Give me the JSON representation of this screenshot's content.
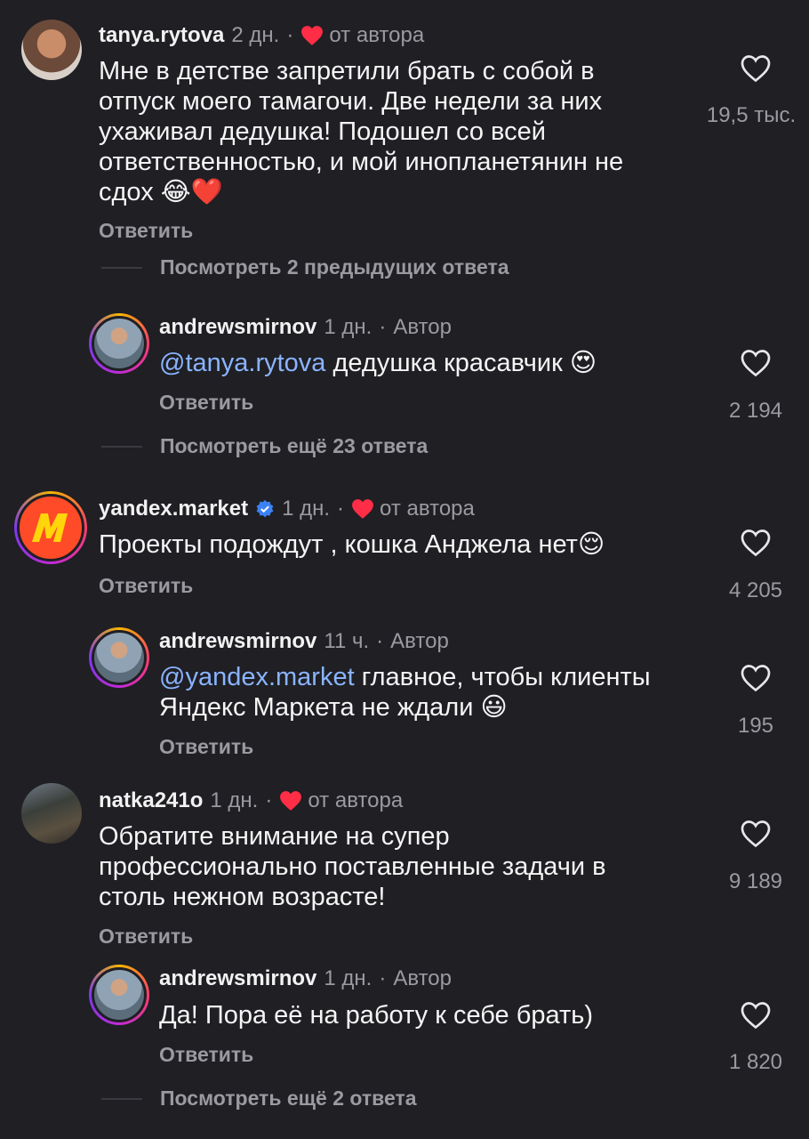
{
  "comments": [
    {
      "user": "tanya.rytova",
      "time": "2 дн.",
      "sep": "·",
      "tag": "от автора",
      "text": "Мне в детстве запретили брать с собой в отпуск моего тамагочи. Две недели за них ухаживал дедушка! Подошел со всей ответственностью, и мой инопланетянин не сдох 😂❤️",
      "reply": "Ответить",
      "likes": "19,5 тыс.",
      "view_more": "Посмотреть 2 предыдущих ответа"
    },
    {
      "user": "andrewsmirnov",
      "time": "1 дн.",
      "sep": "·",
      "tag": "Автор",
      "mention": "@tanya.rytova",
      "text": " дедушка красавчик 😍",
      "reply": "Ответить",
      "likes": "2 194",
      "view_more": "Посмотреть ещё 23 ответа"
    },
    {
      "user": "yandex.market",
      "time": "1 дн.",
      "sep": "·",
      "tag": "от автора",
      "text": "Проекты подождут , кошка Анджела нет😌",
      "reply": "Ответить",
      "likes": "4 205"
    },
    {
      "user": "andrewsmirnov",
      "time": "11 ч.",
      "sep": "·",
      "tag": "Автор",
      "mention": "@yandex.market",
      "text": " главное, чтобы клиенты Яндекс Маркета не ждали 😃",
      "reply": "Ответить",
      "likes": "195"
    },
    {
      "user": "natka241o",
      "time": "1 дн.",
      "sep": "·",
      "tag": "от автора",
      "text": "Обратите внимание на  супер профессионально поставленные задачи в столь нежном возрасте!",
      "reply": "Ответить",
      "likes": "9 189"
    },
    {
      "user": "andrewsmirnov",
      "time": "1 дн.",
      "sep": "·",
      "tag": "Автор",
      "text": "Да! Пора её на работу к себе брать)",
      "reply": "Ответить",
      "likes": "1 820",
      "view_more": "Посмотреть ещё 2 ответа"
    }
  ],
  "colors": {
    "background": "#1f1f24",
    "heart_red": "#ff2d45",
    "mention": "#8ab4ff",
    "muted": "#9a9aa0",
    "verified": "#3b82f6"
  },
  "icons": {
    "like": "heart-outline-icon",
    "author_like": "heart-filled-icon",
    "verified": "verified-badge-icon"
  }
}
